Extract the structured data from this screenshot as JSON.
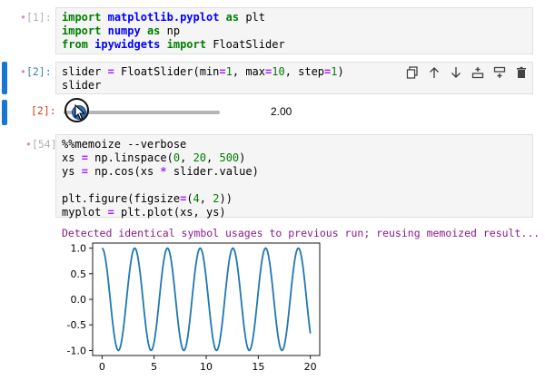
{
  "cells": [
    {
      "prompt": "[1]:",
      "lines": [
        [
          {
            "t": "import",
            "c": "kw"
          },
          {
            "t": " "
          },
          {
            "t": "matplotlib.pyplot",
            "c": "mod"
          },
          {
            "t": " "
          },
          {
            "t": "as",
            "c": "kw"
          },
          {
            "t": " plt"
          }
        ],
        [
          {
            "t": "import",
            "c": "kw"
          },
          {
            "t": " "
          },
          {
            "t": "numpy",
            "c": "mod"
          },
          {
            "t": " "
          },
          {
            "t": "as",
            "c": "kw"
          },
          {
            "t": " np"
          }
        ],
        [
          {
            "t": "from",
            "c": "kw"
          },
          {
            "t": " "
          },
          {
            "t": "ipywidgets",
            "c": "mod"
          },
          {
            "t": " "
          },
          {
            "t": "import",
            "c": "kw"
          },
          {
            "t": " FloatSlider"
          }
        ]
      ]
    },
    {
      "prompt": "[2]:",
      "lines": [
        [
          {
            "t": "slider "
          },
          {
            "t": "=",
            "c": "op"
          },
          {
            "t": " FloatSlider(min"
          },
          {
            "t": "=",
            "c": "op"
          },
          {
            "t": "1",
            "c": "num"
          },
          {
            "t": ", max"
          },
          {
            "t": "=",
            "c": "op"
          },
          {
            "t": "10",
            "c": "num"
          },
          {
            "t": ", step"
          },
          {
            "t": "=",
            "c": "op"
          },
          {
            "t": "1",
            "c": "num"
          },
          {
            "t": ")"
          }
        ],
        [
          {
            "t": "slider"
          }
        ]
      ]
    },
    {
      "prompt": "[54]:",
      "lines": [
        [
          {
            "t": "%%memoize --verbose",
            "c": "magic"
          }
        ],
        [
          {
            "t": "xs "
          },
          {
            "t": "=",
            "c": "op"
          },
          {
            "t": " np"
          },
          {
            "t": "."
          },
          {
            "t": "linspace",
            "c": ""
          },
          {
            "t": "("
          },
          {
            "t": "0",
            "c": "num"
          },
          {
            "t": ", "
          },
          {
            "t": "20",
            "c": "num"
          },
          {
            "t": ", "
          },
          {
            "t": "500",
            "c": "num"
          },
          {
            "t": ")"
          }
        ],
        [
          {
            "t": "ys "
          },
          {
            "t": "=",
            "c": "op"
          },
          {
            "t": " np"
          },
          {
            "t": "."
          },
          {
            "t": "cos(xs "
          },
          {
            "t": "*",
            "c": "op"
          },
          {
            "t": " slider"
          },
          {
            "t": "."
          },
          {
            "t": "value)"
          }
        ],
        [
          {
            "t": ""
          }
        ],
        [
          {
            "t": "plt"
          },
          {
            "t": "."
          },
          {
            "t": "figure(figsize"
          },
          {
            "t": "=",
            "c": "op"
          },
          {
            "t": "("
          },
          {
            "t": "4",
            "c": "num"
          },
          {
            "t": ", "
          },
          {
            "t": "2",
            "c": "num"
          },
          {
            "t": "))"
          }
        ],
        [
          {
            "t": "myplot "
          },
          {
            "t": "=",
            "c": "op"
          },
          {
            "t": " plt"
          },
          {
            "t": "."
          },
          {
            "t": "plot(xs, ys)"
          }
        ]
      ]
    }
  ],
  "output_prompt": "[2]:",
  "slider": {
    "value": 2,
    "value_label": "2.00",
    "min": 1,
    "max": 10
  },
  "stream_output": "Detected identical symbol usages to previous run; reusing memoized result...",
  "toolbar": [
    "duplicate-icon",
    "move-up-icon",
    "move-down-icon",
    "insert-above-icon",
    "insert-below-icon",
    "delete-icon"
  ],
  "colors": {
    "accent": "#1976d2",
    "line": "#1f77b4",
    "stream": "#8b1a8b"
  },
  "chart_data": {
    "type": "line",
    "title": "",
    "xlabel": "",
    "ylabel": "",
    "xlim": [
      -0.9,
      20.9
    ],
    "ylim": [
      -1.1,
      1.1
    ],
    "x_ticks": [
      "0",
      "5",
      "10",
      "15",
      "20"
    ],
    "y_ticks": [
      "1.0",
      "0.5",
      "0.0",
      "-0.5",
      "-1.0"
    ],
    "series": [
      {
        "function": "cos(2x)",
        "x_range": [
          0,
          20
        ],
        "points": 500
      }
    ]
  }
}
